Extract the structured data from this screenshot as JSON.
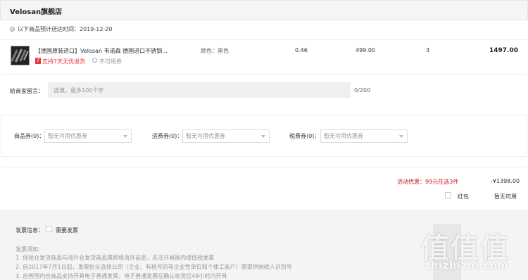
{
  "store": {
    "name": "Velosan旗舰店"
  },
  "delivery": {
    "text": "以下商品预计送达时间：2019-12-20"
  },
  "item": {
    "title": "【德国原装进口】Velosan 韦诺森 德国进口不锈钢...",
    "badge": "7",
    "return_policy": "支持7天无忧退货",
    "coupon_note": "不可用券",
    "color": "颜色：黑色",
    "weight": "0.46",
    "price": "499.00",
    "quantity": "3",
    "subtotal": "1497.00"
  },
  "message": {
    "label": "给商家留言：",
    "placeholder": "选填，最多100个字",
    "count": "0/200"
  },
  "coupons": [
    {
      "label": "商品券(0)：",
      "value": "暂无可用优惠券"
    },
    {
      "label": "运费券(0)：",
      "value": "暂无可用优惠券"
    },
    {
      "label": "税费券(0)：",
      "value": "暂无可用优惠券"
    }
  ],
  "promo": {
    "label": "活动优惠：99元任选3件",
    "amount": "-¥1398.00",
    "hongbao_label": "红包",
    "hongbao_status": "暂无可用"
  },
  "invoice": {
    "label": "发票信息：",
    "need_label": "需要发票",
    "notes_title": "发票须知：",
    "notes": [
      "1. 保税仓发货商品与海外仓发货商品属跨境海外商品，无法开具国内增值税发票",
      "2. 自2017年7月1日起，发票抬头选择公司（企业、有税号的非企业性单位和个体工商户）需提供纳税人识别号",
      "3. 自营国内仓商品支持开具电子普通发票，电子普通发票在确认收货后48小时内开具"
    ]
  },
  "watermark": {
    "big": "值值值",
    "text": "zhizhizhi.com"
  },
  "colors": {
    "accent_red": "#e4393c",
    "promo_red": "#c71d23",
    "bg_gray": "#f4f4f4"
  }
}
